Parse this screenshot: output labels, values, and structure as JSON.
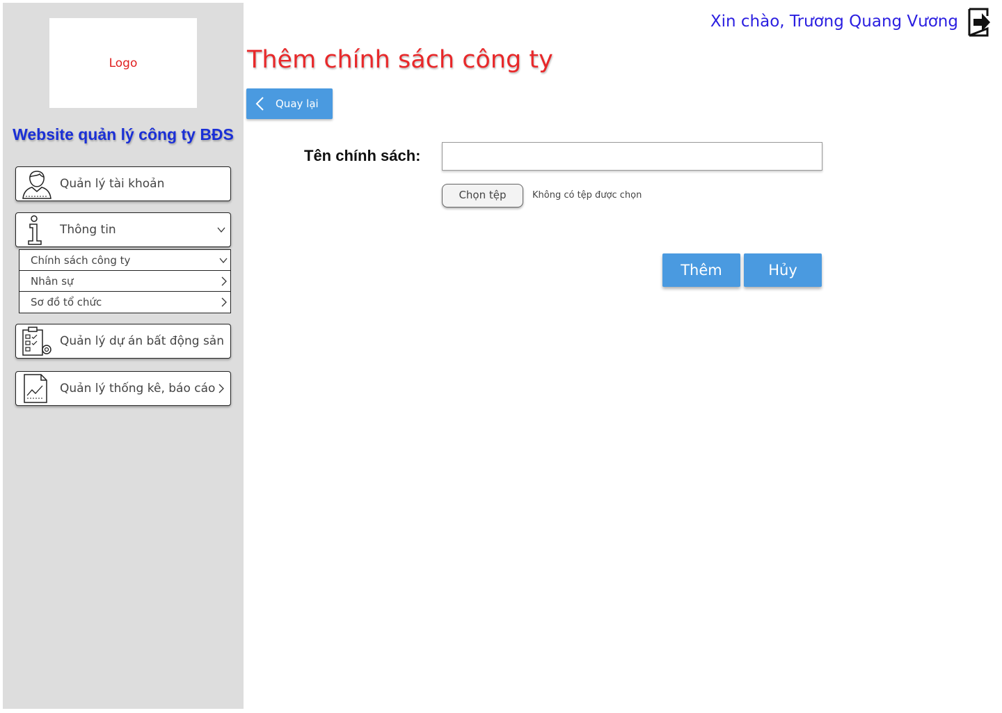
{
  "sidebar": {
    "logo_text": "Logo",
    "site_title": "Website quản lý công ty BĐS",
    "menu": {
      "account": "Quản lý tài khoản",
      "info": "Thông tin",
      "projects": "Quản lý dự án bất động sản",
      "reports": "Quản lý thống kê, báo cáo"
    },
    "submenu": [
      "Chính sách công ty",
      "Nhân sự",
      "Sơ đồ tổ chức"
    ]
  },
  "header": {
    "greeting": "Xin chào, Trương Quang Vương"
  },
  "main": {
    "title": "Thêm chính sách công ty",
    "back_label": "Quay lại",
    "field_label": "Tên chính sách:",
    "field_value": "",
    "file_button": "Chọn tệp",
    "file_status": "Không có tệp được chọn",
    "add_label": "Thêm",
    "cancel_label": "Hủy"
  },
  "colors": {
    "accent_blue": "#4a9ae0",
    "title_red": "#e8282a",
    "greeting_blue": "#2a1ee0",
    "site_title_blue": "#1a2fd6",
    "sidebar_bg": "#dddddd"
  }
}
